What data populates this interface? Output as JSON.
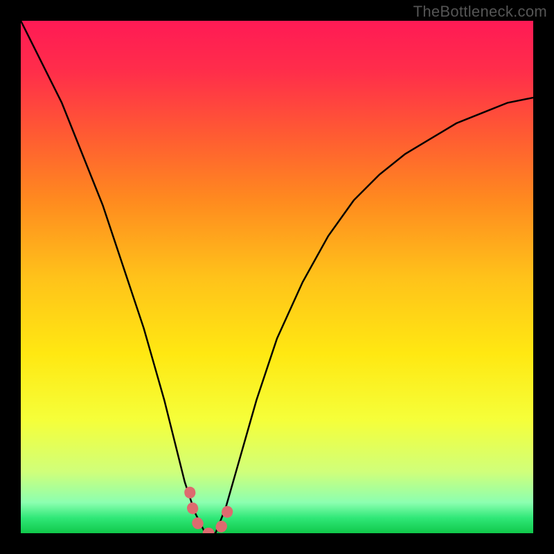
{
  "watermark": {
    "text": "TheBottleneck.com"
  },
  "chart_data": {
    "type": "line",
    "title": "",
    "xlabel": "",
    "ylabel": "",
    "xlim": [
      0,
      100
    ],
    "ylim": [
      0,
      100
    ],
    "series": [
      {
        "name": "bottleneck-curve",
        "x": [
          0,
          2,
          4,
          6,
          8,
          10,
          12,
          14,
          16,
          18,
          20,
          22,
          24,
          26,
          28,
          30,
          32,
          34,
          36,
          38,
          40,
          42,
          44,
          46,
          48,
          50,
          55,
          60,
          65,
          70,
          75,
          80,
          85,
          90,
          95,
          100
        ],
        "y": [
          100,
          96,
          92,
          88,
          84,
          79,
          74,
          69,
          64,
          58,
          52,
          46,
          40,
          33,
          26,
          18,
          10,
          4,
          0,
          0,
          5,
          12,
          19,
          26,
          32,
          38,
          49,
          58,
          65,
          70,
          74,
          77,
          80,
          82,
          84,
          85
        ]
      }
    ],
    "highlight": {
      "name": "optimal-range",
      "points": [
        {
          "x": 33.0,
          "y": 8
        },
        {
          "x": 33.5,
          "y": 5
        },
        {
          "x": 34.0,
          "y": 3
        },
        {
          "x": 35.0,
          "y": 1
        },
        {
          "x": 36.0,
          "y": 0
        },
        {
          "x": 37.0,
          "y": 0
        },
        {
          "x": 38.0,
          "y": 0
        },
        {
          "x": 39.0,
          "y": 1
        },
        {
          "x": 40.0,
          "y": 3
        },
        {
          "x": 40.5,
          "y": 5
        },
        {
          "x": 41.0,
          "y": 7
        }
      ]
    },
    "gradient_stops": [
      {
        "offset": 0.0,
        "color": "#ff1a55"
      },
      {
        "offset": 0.1,
        "color": "#ff2e4a"
      },
      {
        "offset": 0.22,
        "color": "#ff5a33"
      },
      {
        "offset": 0.35,
        "color": "#ff8a1f"
      },
      {
        "offset": 0.5,
        "color": "#ffc21a"
      },
      {
        "offset": 0.65,
        "color": "#ffe812"
      },
      {
        "offset": 0.78,
        "color": "#f5ff3a"
      },
      {
        "offset": 0.88,
        "color": "#d0ff7a"
      },
      {
        "offset": 0.94,
        "color": "#8cffb0"
      },
      {
        "offset": 0.97,
        "color": "#30e878"
      },
      {
        "offset": 1.0,
        "color": "#10c84a"
      }
    ]
  }
}
